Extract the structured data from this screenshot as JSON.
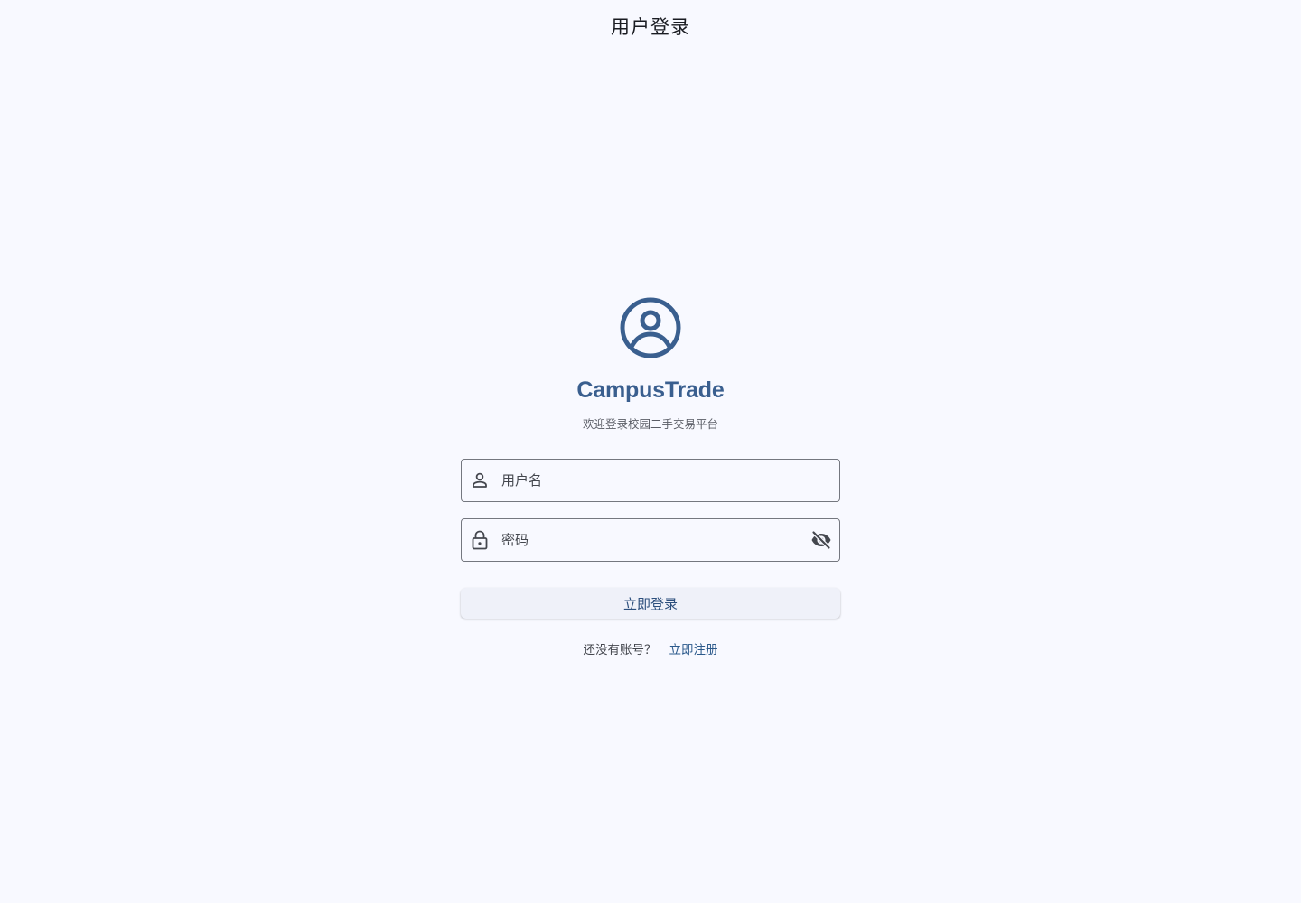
{
  "appbar": {
    "title": "用户登录"
  },
  "brand": {
    "logo_icon": "account-circle-icon",
    "name": "CampusTrade",
    "subtitle": "欢迎登录校园二手交易平台",
    "color": "#3a5f8f"
  },
  "form": {
    "username": {
      "icon": "person-icon",
      "placeholder": "用户名",
      "value": ""
    },
    "password": {
      "icon": "lock-icon",
      "placeholder": "密码",
      "value": "",
      "toggle_icon": "visibility-off-icon"
    },
    "login_label": "立即登录"
  },
  "register": {
    "hint": "还没有账号？",
    "link_label": "立即注册"
  }
}
